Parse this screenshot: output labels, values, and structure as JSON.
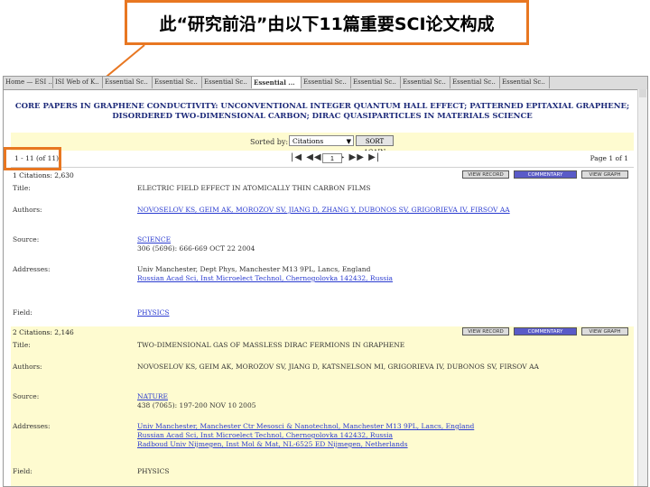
{
  "slide": {
    "title": "此“研究前沿”由以下11篇重要SCI论文构成"
  },
  "browser": {
    "tabs": [
      "Home — ESI ..",
      "ISI Web of K..",
      "Essential Sc..",
      "Essential Sc..",
      "Essential Sc..",
      "Essential ...",
      "Essential Sc..",
      "Essential Sc..",
      "Essential Sc..",
      "Essential Sc..",
      "Essential Sc.."
    ],
    "active_tab": 5
  },
  "page": {
    "header_line1": "CORE PAPERS IN GRAPHENE CONDUCTIVITY: UNCONVENTIONAL INTEGER QUANTUM HALL EFFECT; PATTERNED EPITAXIAL GRAPHENE;",
    "header_line2": "DISORDERED TWO-DIMENSIONAL CARBON; DIRAC QUASIPARTICLES IN MATERIALS SCIENCE",
    "sorted_by_label": "Sorted by:",
    "sort_value": "Citations",
    "sort_button": "SORT AGAIN",
    "range_text": "1 - 11 (of 11)",
    "pager_arrows": "|◀ ◀◀ ◀   ▶ ▶▶ ▶|",
    "page_input": "1",
    "page_of": "Page 1 of 1"
  },
  "buttons": {
    "more": "VIEW RECORD",
    "comment": "COMMENTARY",
    "graph": "VIEW GRAPH"
  },
  "records": [
    {
      "num": "1  Citations: 2,630",
      "title_label": "Title:",
      "title": "ELECTRIC FIELD EFFECT IN ATOMICALLY THIN CARBON FILMS",
      "authors_label": "Authors:",
      "authors": "NOVOSELOV KS, GEIM AK, MOROZOV SV, JIANG D, ZHANG Y, DUBONOS SV, GRIGORIEVA IV, FIRSOV AA",
      "source_label": "Source:",
      "source1": "SCIENCE",
      "source2": "306 (5696): 666-669 OCT 22 2004",
      "addr_label": "Addresses:",
      "addr1": "Univ Manchester, Dept Phys, Manchester M13 9PL, Lancs, England",
      "addr2": "Russian Acad Sci, Inst Microelect Technol, Chernogolovka 142432, Russia",
      "field_label": "Field:",
      "field": "PHYSICS"
    },
    {
      "num": "2  Citations: 2,146",
      "title_label": "Title:",
      "title": "TWO-DIMENSIONAL GAS OF MASSLESS DIRAC FERMIONS IN GRAPHENE",
      "authors_label": "Authors:",
      "authors": "NOVOSELOV KS, GEIM AK, MOROZOV SV, JIANG D, KATSNELSON MI, GRIGORIEVA IV, DUBONOS SV, FIRSOV AA",
      "source_label": "Source:",
      "source1": "NATURE",
      "source2": "438 (7065): 197-200 NOV 10 2005",
      "addr_label": "Addresses:",
      "addr1": "Univ Manchester, Manchester Ctr Mesosci & Nanotechnol, Manchester M13 9PL, Lancs, England",
      "addr2": "Russian Acad Sci, Inst Microelect Technol, Chernogolovka 142432, Russia",
      "addr3": "Radboud Univ Nijmegen, Inst Mol & Mat, NL-6525 ED Nijmegen, Netherlands",
      "field_label": "Field:",
      "field": "PHYSICS"
    }
  ]
}
